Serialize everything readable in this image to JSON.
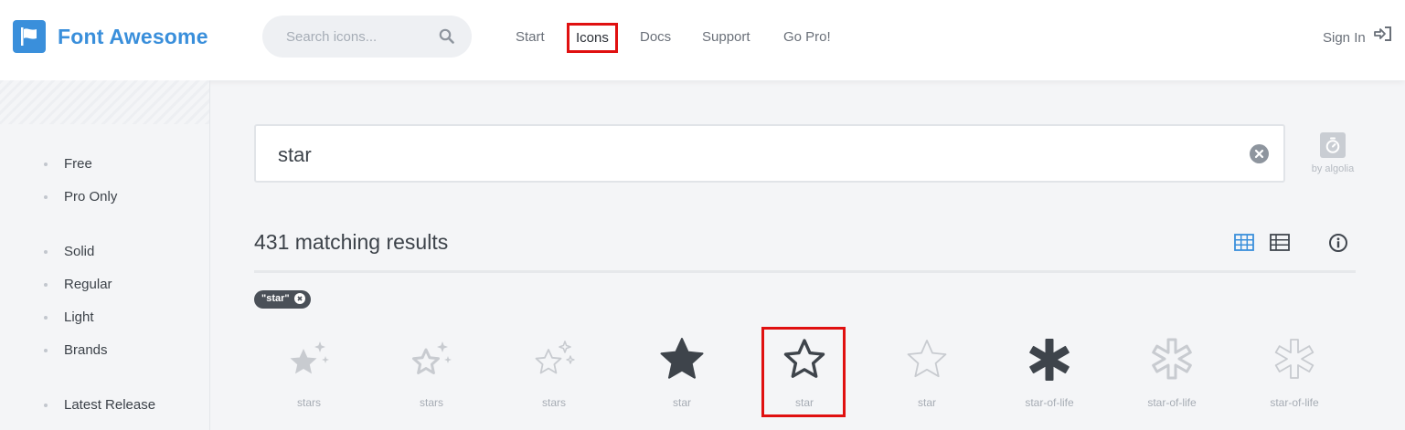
{
  "brand": {
    "name": "Font Awesome",
    "logo_icon": "flag-icon",
    "color": "#3a8fdb"
  },
  "header": {
    "search_placeholder": "Search icons...",
    "nav": [
      "Start",
      "Icons",
      "Docs",
      "Support",
      "Go Pro!"
    ],
    "active_nav": "Icons",
    "sign_in": "Sign In"
  },
  "sidebar": {
    "groups": [
      [
        "Free",
        "Pro Only"
      ],
      [
        "Solid",
        "Regular",
        "Light",
        "Brands"
      ],
      [
        "Latest Release"
      ]
    ]
  },
  "search": {
    "query": "star",
    "provider_label": "by algolia"
  },
  "results": {
    "count_text": "431 matching results",
    "filter_tag": "\"star\"",
    "icons": [
      {
        "name": "stars",
        "icon": "stars-solid-icon"
      },
      {
        "name": "stars",
        "icon": "stars-regular-icon"
      },
      {
        "name": "stars",
        "icon": "stars-light-icon"
      },
      {
        "name": "star",
        "icon": "star-solid-icon"
      },
      {
        "name": "star",
        "icon": "star-regular-icon"
      },
      {
        "name": "star",
        "icon": "star-light-icon"
      },
      {
        "name": "star-of-life",
        "icon": "star-of-life-solid-icon"
      },
      {
        "name": "star-of-life",
        "icon": "star-of-life-regular-icon"
      },
      {
        "name": "star-of-life",
        "icon": "star-of-life-light-icon"
      }
    ],
    "selected_index": 4
  },
  "colors": {
    "highlight": "#e01010",
    "accent": "#3a8fdb"
  }
}
